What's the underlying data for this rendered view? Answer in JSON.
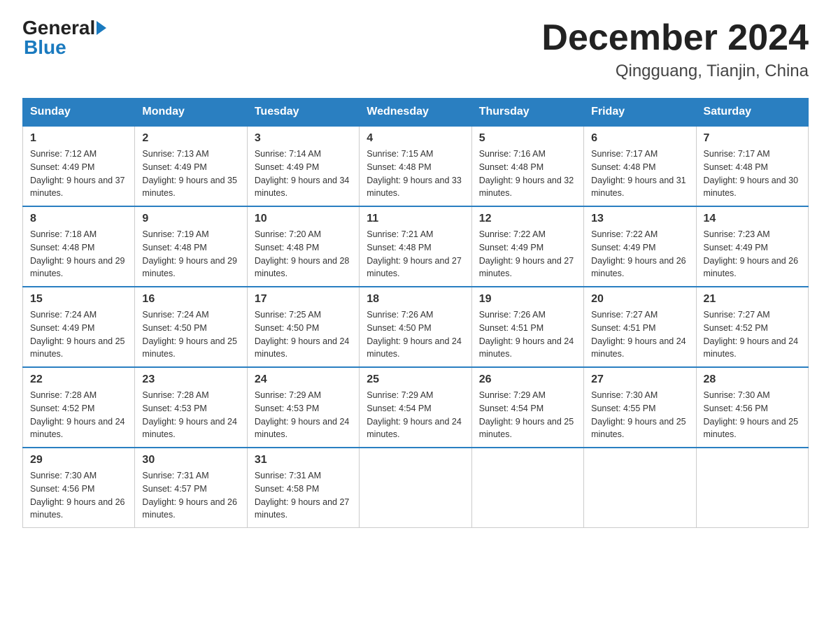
{
  "header": {
    "logo_general": "General",
    "logo_blue": "Blue",
    "title": "December 2024",
    "subtitle": "Qingguang, Tianjin, China"
  },
  "days_of_week": [
    "Sunday",
    "Monday",
    "Tuesday",
    "Wednesday",
    "Thursday",
    "Friday",
    "Saturday"
  ],
  "weeks": [
    [
      {
        "num": "1",
        "sunrise": "7:12 AM",
        "sunset": "4:49 PM",
        "daylight": "9 hours and 37 minutes."
      },
      {
        "num": "2",
        "sunrise": "7:13 AM",
        "sunset": "4:49 PM",
        "daylight": "9 hours and 35 minutes."
      },
      {
        "num": "3",
        "sunrise": "7:14 AM",
        "sunset": "4:49 PM",
        "daylight": "9 hours and 34 minutes."
      },
      {
        "num": "4",
        "sunrise": "7:15 AM",
        "sunset": "4:48 PM",
        "daylight": "9 hours and 33 minutes."
      },
      {
        "num": "5",
        "sunrise": "7:16 AM",
        "sunset": "4:48 PM",
        "daylight": "9 hours and 32 minutes."
      },
      {
        "num": "6",
        "sunrise": "7:17 AM",
        "sunset": "4:48 PM",
        "daylight": "9 hours and 31 minutes."
      },
      {
        "num": "7",
        "sunrise": "7:17 AM",
        "sunset": "4:48 PM",
        "daylight": "9 hours and 30 minutes."
      }
    ],
    [
      {
        "num": "8",
        "sunrise": "7:18 AM",
        "sunset": "4:48 PM",
        "daylight": "9 hours and 29 minutes."
      },
      {
        "num": "9",
        "sunrise": "7:19 AM",
        "sunset": "4:48 PM",
        "daylight": "9 hours and 29 minutes."
      },
      {
        "num": "10",
        "sunrise": "7:20 AM",
        "sunset": "4:48 PM",
        "daylight": "9 hours and 28 minutes."
      },
      {
        "num": "11",
        "sunrise": "7:21 AM",
        "sunset": "4:48 PM",
        "daylight": "9 hours and 27 minutes."
      },
      {
        "num": "12",
        "sunrise": "7:22 AM",
        "sunset": "4:49 PM",
        "daylight": "9 hours and 27 minutes."
      },
      {
        "num": "13",
        "sunrise": "7:22 AM",
        "sunset": "4:49 PM",
        "daylight": "9 hours and 26 minutes."
      },
      {
        "num": "14",
        "sunrise": "7:23 AM",
        "sunset": "4:49 PM",
        "daylight": "9 hours and 26 minutes."
      }
    ],
    [
      {
        "num": "15",
        "sunrise": "7:24 AM",
        "sunset": "4:49 PM",
        "daylight": "9 hours and 25 minutes."
      },
      {
        "num": "16",
        "sunrise": "7:24 AM",
        "sunset": "4:50 PM",
        "daylight": "9 hours and 25 minutes."
      },
      {
        "num": "17",
        "sunrise": "7:25 AM",
        "sunset": "4:50 PM",
        "daylight": "9 hours and 24 minutes."
      },
      {
        "num": "18",
        "sunrise": "7:26 AM",
        "sunset": "4:50 PM",
        "daylight": "9 hours and 24 minutes."
      },
      {
        "num": "19",
        "sunrise": "7:26 AM",
        "sunset": "4:51 PM",
        "daylight": "9 hours and 24 minutes."
      },
      {
        "num": "20",
        "sunrise": "7:27 AM",
        "sunset": "4:51 PM",
        "daylight": "9 hours and 24 minutes."
      },
      {
        "num": "21",
        "sunrise": "7:27 AM",
        "sunset": "4:52 PM",
        "daylight": "9 hours and 24 minutes."
      }
    ],
    [
      {
        "num": "22",
        "sunrise": "7:28 AM",
        "sunset": "4:52 PM",
        "daylight": "9 hours and 24 minutes."
      },
      {
        "num": "23",
        "sunrise": "7:28 AM",
        "sunset": "4:53 PM",
        "daylight": "9 hours and 24 minutes."
      },
      {
        "num": "24",
        "sunrise": "7:29 AM",
        "sunset": "4:53 PM",
        "daylight": "9 hours and 24 minutes."
      },
      {
        "num": "25",
        "sunrise": "7:29 AM",
        "sunset": "4:54 PM",
        "daylight": "9 hours and 24 minutes."
      },
      {
        "num": "26",
        "sunrise": "7:29 AM",
        "sunset": "4:54 PM",
        "daylight": "9 hours and 25 minutes."
      },
      {
        "num": "27",
        "sunrise": "7:30 AM",
        "sunset": "4:55 PM",
        "daylight": "9 hours and 25 minutes."
      },
      {
        "num": "28",
        "sunrise": "7:30 AM",
        "sunset": "4:56 PM",
        "daylight": "9 hours and 25 minutes."
      }
    ],
    [
      {
        "num": "29",
        "sunrise": "7:30 AM",
        "sunset": "4:56 PM",
        "daylight": "9 hours and 26 minutes."
      },
      {
        "num": "30",
        "sunrise": "7:31 AM",
        "sunset": "4:57 PM",
        "daylight": "9 hours and 26 minutes."
      },
      {
        "num": "31",
        "sunrise": "7:31 AM",
        "sunset": "4:58 PM",
        "daylight": "9 hours and 27 minutes."
      },
      null,
      null,
      null,
      null
    ]
  ]
}
